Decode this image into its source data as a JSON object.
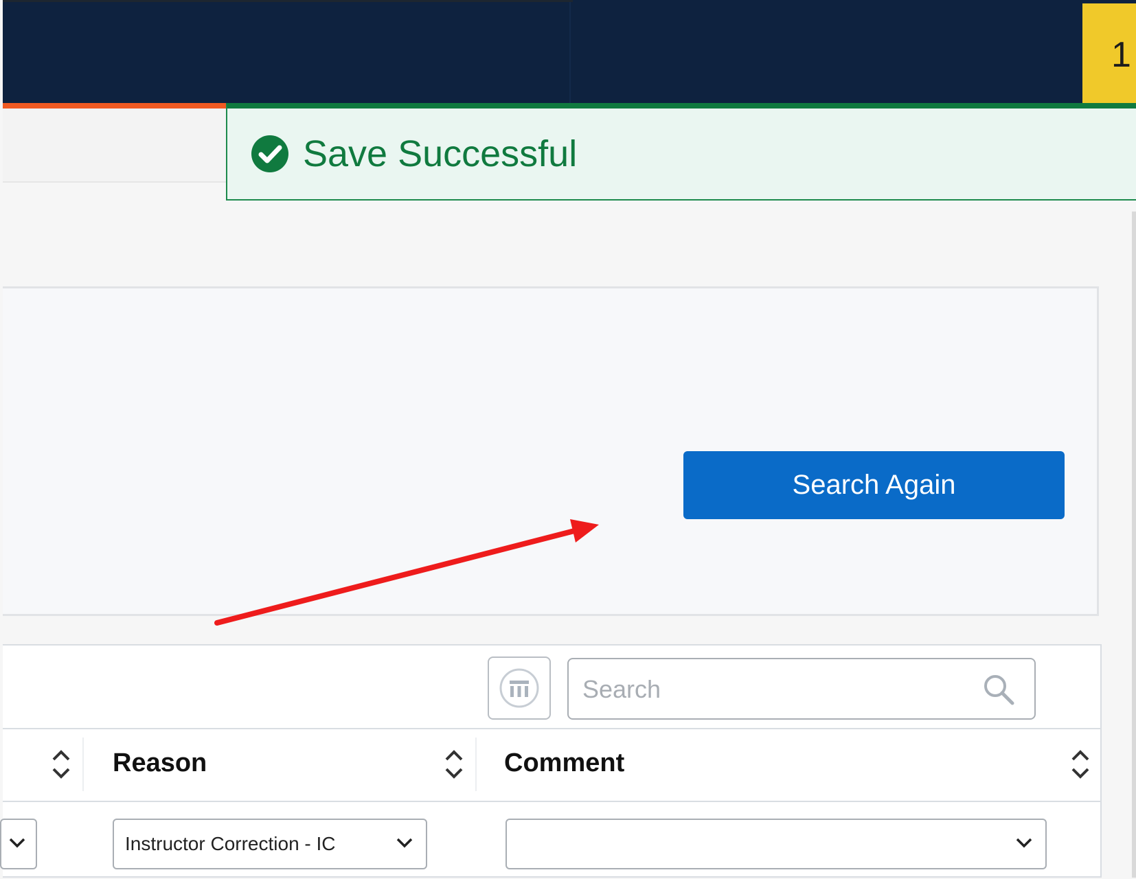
{
  "topbar": {
    "badge_text": "1"
  },
  "toast": {
    "message": "Save Successful",
    "icon": "check-circle-icon",
    "color": "#107a3f"
  },
  "search_panel": {
    "search_again_label": "Search Again"
  },
  "grid": {
    "search_placeholder": "Search",
    "columns": [
      {
        "label": ""
      },
      {
        "label": "Reason"
      },
      {
        "label": "Comment"
      }
    ],
    "row": {
      "first_select_value": "",
      "reason_value": "Instructor Correction - IC",
      "comment_value": ""
    }
  },
  "colors": {
    "navy": "#0e223f",
    "accent_orange": "#f05a22",
    "primary_blue": "#0a6bc8",
    "badge_yellow": "#f0c92a"
  }
}
